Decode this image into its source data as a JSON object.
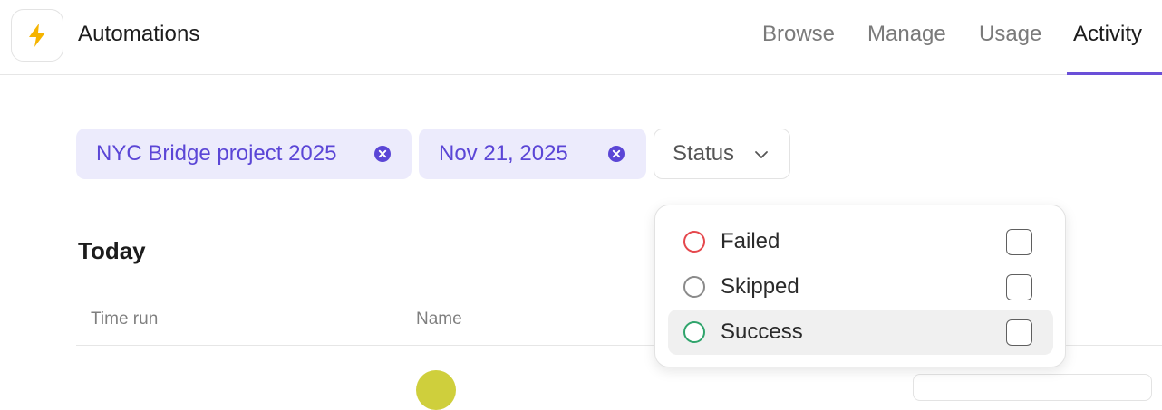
{
  "app": {
    "title": "Automations",
    "icon": "lightning-bolt-icon",
    "icon_color": "#f5b400"
  },
  "nav": {
    "tabs": [
      {
        "label": "Browse",
        "active": false
      },
      {
        "label": "Manage",
        "active": false
      },
      {
        "label": "Usage",
        "active": false
      },
      {
        "label": "Activity",
        "active": true
      }
    ],
    "accent_color": "#6a4fd8"
  },
  "filters": {
    "chips": [
      {
        "label": "NYC Bridge project 2025",
        "removable": true
      },
      {
        "label": "Nov 21, 2025",
        "removable": true
      }
    ],
    "status_button": {
      "label": "Status",
      "icon": "chevron-down-icon"
    },
    "chip_bg": "#ecebfc",
    "chip_text_color": "#5b46d6"
  },
  "section": {
    "title": "Today",
    "columns": [
      "Time run",
      "Name"
    ]
  },
  "status_dropdown": {
    "options": [
      {
        "label": "Failed",
        "color": "#e5484d",
        "checked": false
      },
      {
        "label": "Skipped",
        "color": "#8a8a8a",
        "checked": false
      },
      {
        "label": "Success",
        "color": "#30a46c",
        "checked": false,
        "highlighted": true
      }
    ]
  }
}
